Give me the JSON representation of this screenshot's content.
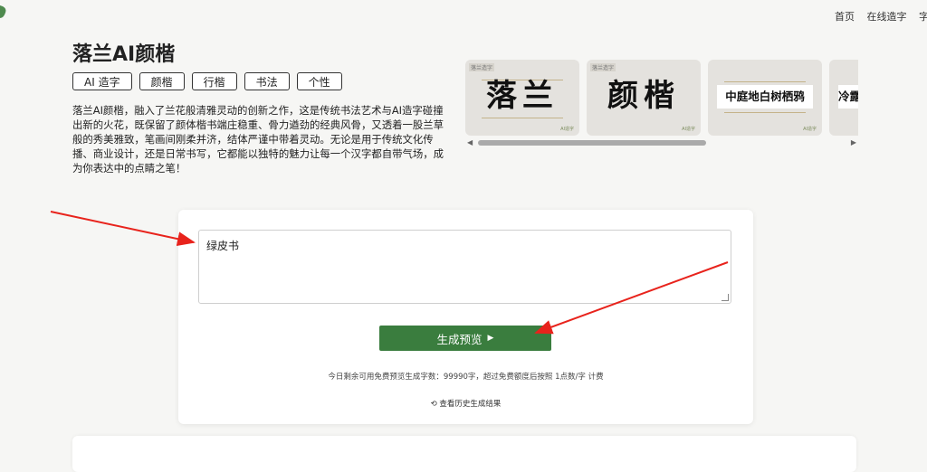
{
  "nav": {
    "items": [
      "首页",
      "在线造字",
      "字"
    ]
  },
  "page": {
    "title": "落兰AI颜楷",
    "tags": [
      "AI 造字",
      "颜楷",
      "行楷",
      "书法",
      "个性"
    ],
    "description": "落兰AI颜楷，融入了兰花般清雅灵动的创新之作，这是传统书法艺术与AI造字碰撞出新的火花，既保留了颜体楷书端庄稳重、骨力遒劲的经典风骨，又透着一股兰草般的秀美雅致，笔画间刚柔并济，结体严谨中带着灵动。无论是用于传统文化传播、商业设计，还是日常书写，它都能以独特的魅力让每一个汉字都自带气场，成为你表达中的点睛之笔！"
  },
  "gallery": {
    "thumbnails": [
      {
        "text": "落兰",
        "style": "large"
      },
      {
        "text": "颜楷",
        "style": "large"
      },
      {
        "text": "中庭地白树栖鸦",
        "style": "small"
      },
      {
        "text": "冷露",
        "style": "small"
      }
    ],
    "scroll_fraction": 0.62
  },
  "generator": {
    "input_value": "绿皮书",
    "button_label": "生成预览",
    "quota_text": "今日剩余可用免费预览生成字数：99990字，超过免费额度后按照 1点数/字 计费",
    "history_label": "查看历史生成结果"
  },
  "colors": {
    "accent": "#3a7d3e",
    "annotation": "#e8231c"
  }
}
